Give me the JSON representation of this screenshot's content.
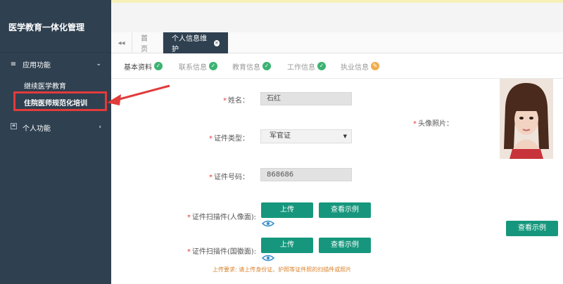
{
  "sidebar": {
    "brand": "医学教育一体化管理",
    "menus": [
      {
        "label": "应用功能",
        "icon": "list-icon",
        "caret": "⌄"
      },
      {
        "label": "个人功能",
        "icon": "id-card-icon",
        "caret": "‹"
      }
    ],
    "submenu": [
      {
        "label": "继续医学教育"
      },
      {
        "label": "住院医师规范化培训"
      }
    ]
  },
  "tabs": {
    "back_icon": "double-chevron-left-icon",
    "home": "首页",
    "active": "个人信息维护"
  },
  "steps": [
    {
      "label": "基本资料",
      "status": "ok"
    },
    {
      "label": "联系信息",
      "status": "ok"
    },
    {
      "label": "教育信息",
      "status": "ok"
    },
    {
      "label": "工作信息",
      "status": "ok"
    },
    {
      "label": "执业信息",
      "status": "edit"
    }
  ],
  "form": {
    "name_label": "姓名：",
    "name_value": "石红",
    "idtype_label": "证件类型：",
    "idtype_value": "军官证",
    "idno_label": "证件号码：",
    "idno_value": "868686",
    "scan_front_label": "证件扫描件(人像面):",
    "scan_back_label": "证件扫描件(国徽面):",
    "upload_label": "上传",
    "example_label": "查看示例",
    "photo_label": "头像照片：",
    "hint": "上传要求: 请上传身份证、护照等证件照的扫描件或照片"
  },
  "colors": {
    "sidebar": "#2f4050",
    "accent": "#16977d",
    "required": "#e23b3b",
    "ok": "#3cb371",
    "warn": "#f0ad4e"
  }
}
